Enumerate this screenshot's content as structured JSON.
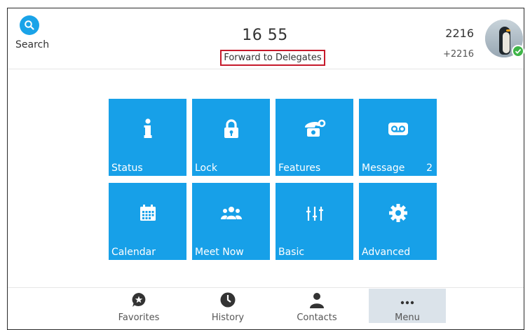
{
  "header": {
    "search_label": "Search",
    "time": "16 55",
    "status": "Forward to Delegates",
    "account_number": "2216",
    "account_sub": "+2216"
  },
  "tiles": [
    {
      "label": "Status",
      "icon": "info-icon",
      "badge": ""
    },
    {
      "label": "Lock",
      "icon": "lock-icon",
      "badge": ""
    },
    {
      "label": "Features",
      "icon": "phone-gear-icon",
      "badge": ""
    },
    {
      "label": "Message",
      "icon": "voicemail-icon",
      "badge": "2"
    },
    {
      "label": "Calendar",
      "icon": "calendar-icon",
      "badge": ""
    },
    {
      "label": "Meet Now",
      "icon": "people-icon",
      "badge": ""
    },
    {
      "label": "Basic",
      "icon": "sliders-icon",
      "badge": ""
    },
    {
      "label": "Advanced",
      "icon": "gear-icon",
      "badge": ""
    }
  ],
  "tabs": [
    {
      "label": "Favorites",
      "icon": "star-bubble-icon"
    },
    {
      "label": "History",
      "icon": "clock-icon"
    },
    {
      "label": "Contacts",
      "icon": "person-icon"
    },
    {
      "label": "Menu",
      "icon": "more-icon",
      "active": true
    }
  ],
  "colors": {
    "tile": "#17a0e8",
    "accent": "#1aa3e8",
    "status_outline": "#c61a2b",
    "online": "#3fb548"
  }
}
